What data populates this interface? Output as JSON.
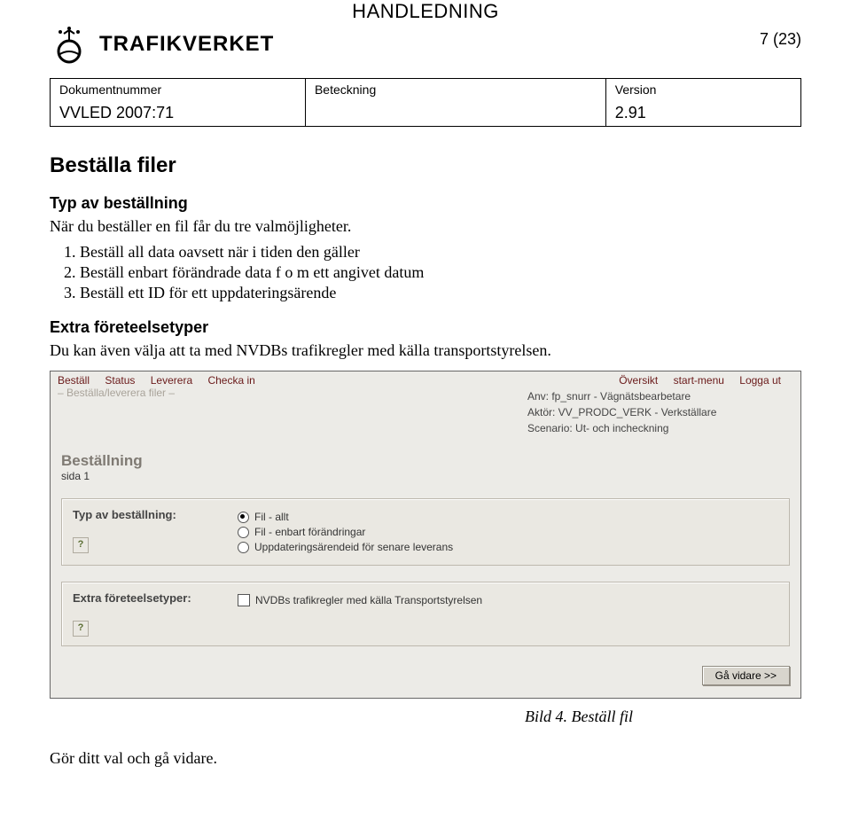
{
  "header": {
    "handledning": "HANDLEDNING",
    "page_number": "7 (23)",
    "brand": "TRAFIKVERKET"
  },
  "meta": {
    "labels": {
      "doknr": "Dokumentnummer",
      "beteckning": "Beteckning",
      "version": "Version"
    },
    "values": {
      "doknr": "VVLED 2007:71",
      "beteckning": "",
      "version": "2.91"
    }
  },
  "h2": "Beställa filer",
  "s1": {
    "title": "Typ av beställning",
    "intro": "När du beställer en fil får du tre valmöjligheter.",
    "items": [
      "Beställ all data oavsett när i tiden den gäller",
      "Beställ enbart förändrade data f o m ett angivet datum",
      "Beställ ett ID för ett uppdateringsärende"
    ]
  },
  "s2": {
    "title": "Extra företeelsetyper",
    "text": "Du kan även välja att ta med NVDBs trafikregler med källa transportstyrelsen."
  },
  "shot": {
    "nav_left": [
      "Beställ",
      "Status",
      "Leverera",
      "Checka in"
    ],
    "nav_right": [
      "Översikt",
      "start-menu",
      "Logga ut"
    ],
    "breadcrumb": "– Beställa/leverera filer –",
    "info": {
      "anv": "Anv: fp_snurr - Vägnätsbearbetare",
      "aktor": "Aktör: VV_PRODC_VERK - Verkställare",
      "scen": "Scenario: Ut- och incheckning"
    },
    "title": "Beställning",
    "sida": "sida 1",
    "panel1": {
      "label": "Typ av beställning:",
      "options": [
        {
          "label": "Fil - allt",
          "selected": true
        },
        {
          "label": "Fil - enbart förändringar",
          "selected": false
        },
        {
          "label": "Uppdateringsärendeid för senare leverans",
          "selected": false
        }
      ]
    },
    "panel2": {
      "label": "Extra företeelsetyper:",
      "checkbox": {
        "label": "NVDBs trafikregler med källa Transportstyrelsen",
        "checked": false
      }
    },
    "button": "Gå vidare >>"
  },
  "caption": "Bild 4. Beställ fil",
  "footer": "Gör ditt val och gå vidare."
}
